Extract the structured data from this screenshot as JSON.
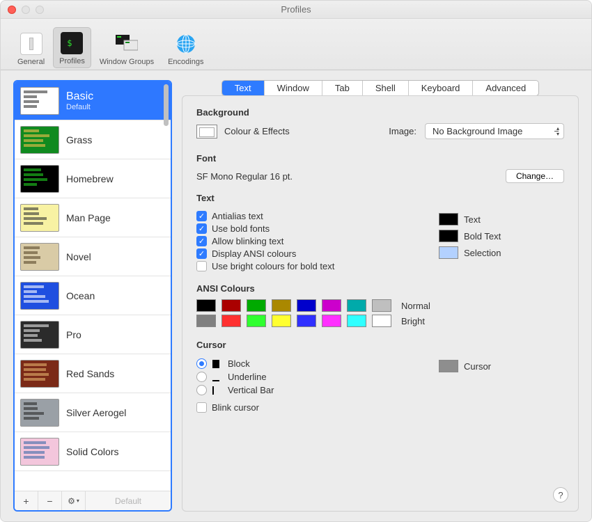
{
  "window": {
    "title": "Profiles"
  },
  "toolbar": {
    "items": [
      {
        "name": "general",
        "label": "General"
      },
      {
        "name": "profiles",
        "label": "Profiles",
        "selected": true
      },
      {
        "name": "window-groups",
        "label": "Window Groups"
      },
      {
        "name": "encodings",
        "label": "Encodings"
      }
    ]
  },
  "sidebar": {
    "profiles": [
      {
        "name": "Basic",
        "subtitle": "Default",
        "selected": true,
        "bg": "#ffffff",
        "fg": "#333333"
      },
      {
        "name": "Grass",
        "bg": "#108a1f",
        "fg": "#f3c24c"
      },
      {
        "name": "Homebrew",
        "bg": "#000000",
        "fg": "#1fd11f"
      },
      {
        "name": "Man Page",
        "bg": "#f8f2a3",
        "fg": "#333333"
      },
      {
        "name": "Novel",
        "bg": "#d9cba6",
        "fg": "#5a4a2c"
      },
      {
        "name": "Ocean",
        "bg": "#1f4fe0",
        "fg": "#ffffff"
      },
      {
        "name": "Pro",
        "bg": "#2b2b2b",
        "fg": "#e6e6e6"
      },
      {
        "name": "Red Sands",
        "bg": "#7b2a17",
        "fg": "#e2b36c"
      },
      {
        "name": "Silver Aerogel",
        "bg": "#9aa0a6",
        "fg": "#2a2a2a"
      },
      {
        "name": "Solid Colors",
        "bg": "#f3c6dc",
        "fg": "#3e6aa8"
      }
    ],
    "footer": {
      "add": "+",
      "remove": "−",
      "actions_icon": "gear",
      "default_label": "Default"
    }
  },
  "tabs": {
    "items": [
      "Text",
      "Window",
      "Tab",
      "Shell",
      "Keyboard",
      "Advanced"
    ],
    "active_index": 0
  },
  "sections": {
    "background": {
      "title": "Background",
      "colour_effects": "Colour & Effects",
      "image_label": "Image:",
      "image_value": "No Background Image"
    },
    "font": {
      "title": "Font",
      "value": "SF Mono Regular 16 pt.",
      "change_label": "Change…"
    },
    "text": {
      "title": "Text",
      "options": [
        {
          "label": "Antialias text",
          "checked": true
        },
        {
          "label": "Use bold fonts",
          "checked": true
        },
        {
          "label": "Allow blinking text",
          "checked": true
        },
        {
          "label": "Display ANSI colours",
          "checked": true
        },
        {
          "label": "Use bright colours for bold text",
          "checked": false
        }
      ],
      "wells": [
        {
          "label": "Text",
          "color": "#000000"
        },
        {
          "label": "Bold Text",
          "color": "#000000"
        },
        {
          "label": "Selection",
          "color": "#b3d1ff"
        }
      ]
    },
    "ansi": {
      "title": "ANSI Colours",
      "normal_label": "Normal",
      "bright_label": "Bright",
      "normal": [
        "#000000",
        "#aa0000",
        "#00aa00",
        "#aa8800",
        "#0000cc",
        "#cc00cc",
        "#00aaaa",
        "#bfbfbf"
      ],
      "bright": [
        "#808080",
        "#ff3030",
        "#30ff30",
        "#ffff30",
        "#3030ff",
        "#ff30ff",
        "#30ffff",
        "#ffffff"
      ]
    },
    "cursor": {
      "title": "Cursor",
      "options": [
        {
          "label": "Block",
          "shape": "block",
          "checked": true
        },
        {
          "label": "Underline",
          "shape": "underline",
          "checked": false
        },
        {
          "label": "Vertical Bar",
          "shape": "vbar",
          "checked": false
        }
      ],
      "blink_label": "Blink cursor",
      "blink_checked": false,
      "well_label": "Cursor",
      "well_color": "#8e8e8e"
    }
  },
  "help_label": "?"
}
